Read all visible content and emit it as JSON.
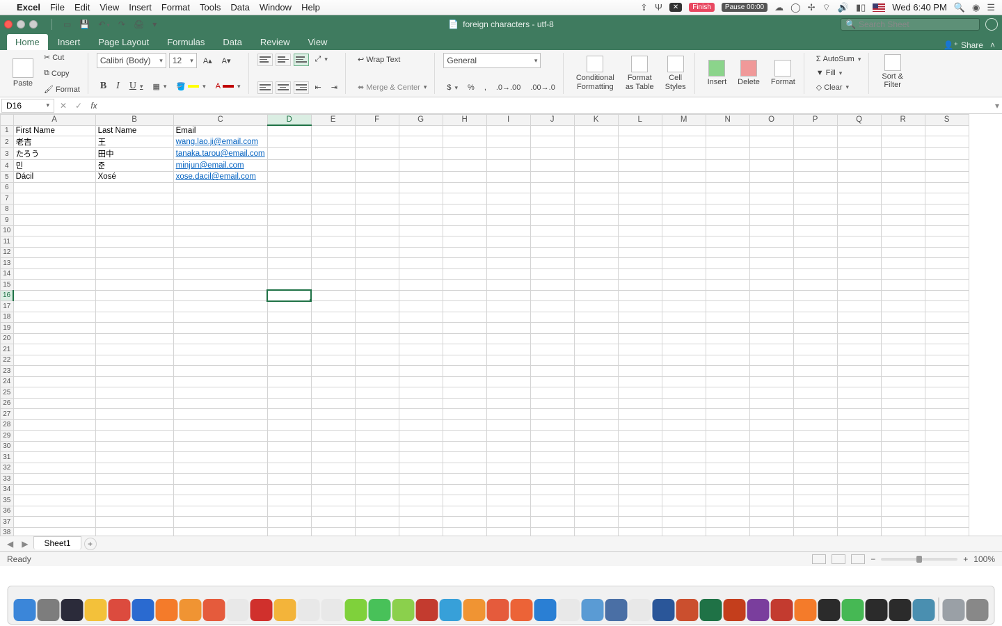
{
  "mac": {
    "app": "Excel",
    "menus": [
      "File",
      "Edit",
      "View",
      "Insert",
      "Format",
      "Tools",
      "Data",
      "Window",
      "Help"
    ],
    "status_x": "✕",
    "status_finish": "Finish",
    "status_pause": "Pause 00:00",
    "clock": "Wed 6:40 PM"
  },
  "titlebar": {
    "doc_title": "foreign characters - utf-8",
    "search_placeholder": "Search Sheet"
  },
  "ribbon": {
    "tabs": [
      "Home",
      "Insert",
      "Page Layout",
      "Formulas",
      "Data",
      "Review",
      "View"
    ],
    "active_tab": "Home",
    "share": "Share",
    "paste": "Paste",
    "cut": "Cut",
    "copy": "Copy",
    "format_painter": "Format",
    "font_name": "Calibri (Body)",
    "font_size": "12",
    "wrap": "Wrap Text",
    "merge": "Merge & Center",
    "number_format": "General",
    "cond": "Conditional\nFormatting",
    "fmt_table": "Format\nas Table",
    "cell_styles": "Cell\nStyles",
    "insert": "Insert",
    "delete": "Delete",
    "format": "Format",
    "autosum": "AutoSum",
    "fill": "Fill",
    "clear": "Clear",
    "sort": "Sort &\nFilter"
  },
  "formula": {
    "namebox": "D16",
    "value": ""
  },
  "grid": {
    "columns": [
      "A",
      "B",
      "C",
      "D",
      "E",
      "F",
      "G",
      "H",
      "I",
      "J",
      "K",
      "L",
      "M",
      "N",
      "O",
      "P",
      "Q",
      "R",
      "S"
    ],
    "headers": {
      "A": "First Name",
      "B": "Last Name",
      "C": "Email"
    },
    "rows": [
      {
        "A": "老吉",
        "B": "王",
        "C": "wang.lao.ji@email.com"
      },
      {
        "A": "たろう",
        "B": "田中",
        "C": "tanaka.tarou@email.com"
      },
      {
        "A": "민",
        "B": "준",
        "C": "minjun@email.com"
      },
      {
        "A": "Dácil",
        "B": "Xosé",
        "C": "xose.dacil@email.com"
      }
    ],
    "active_cell": "D16",
    "row_count": 38
  },
  "sheets": {
    "active": "Sheet1"
  },
  "status": {
    "ready": "Ready",
    "zoom": "100%"
  },
  "dock_colors": [
    "#3b86d9",
    "#7d7d7d",
    "#2b2b3a",
    "#f3c13a",
    "#dc4b3e",
    "#2a6ad0",
    "#f47b2a",
    "#f09433",
    "#e55b3c",
    "#e8e8e8",
    "#d0302c",
    "#f3b43a",
    "#e8e8e8",
    "#e8e8e8",
    "#7fd13b",
    "#48c159",
    "#8bd04c",
    "#c33b2f",
    "#37a0d9",
    "#f09433",
    "#e55b3c",
    "#ec6337",
    "#2a7fd4",
    "#e8e8e8",
    "#5a9bd4",
    "#4a6fa5",
    "#e8e8e8",
    "#2a5699",
    "#cb4f2e",
    "#1f7246",
    "#c43e1c",
    "#7a3e9d",
    "#c33b2f",
    "#f47b2a",
    "#2b2b2b",
    "#46b854",
    "#2b2b2b",
    "#2b2b2b",
    "#4a8fb0",
    "#9aa0a6",
    "#888"
  ]
}
